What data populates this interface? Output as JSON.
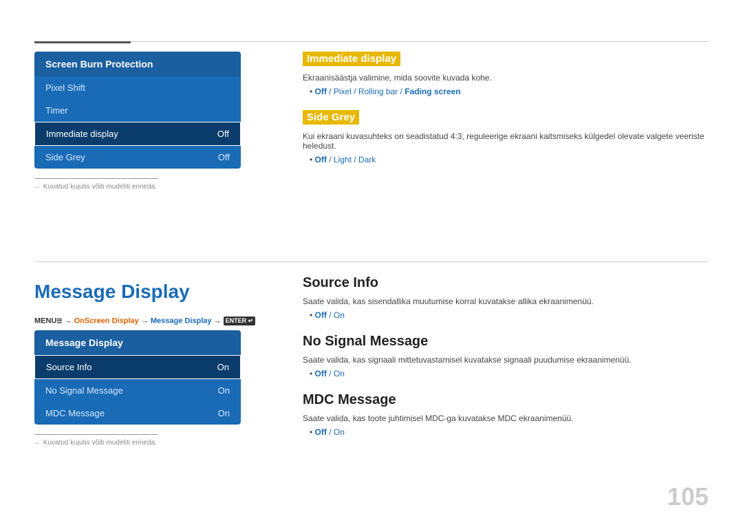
{
  "topRule": true,
  "leftTop": {
    "panel": {
      "title": "Screen Burn Protection",
      "items": [
        {
          "label": "Pixel Shift",
          "value": "",
          "active": false
        },
        {
          "label": "Timer",
          "value": "",
          "active": false
        },
        {
          "label": "Immediate display",
          "value": "Off",
          "active": true
        },
        {
          "label": "Side Grey",
          "value": "Off",
          "active": false
        }
      ]
    },
    "note": "← Kuvatud kujutis võib mudeliti erineda."
  },
  "rightTop": {
    "sections": [
      {
        "title": "Immediate display",
        "desc": "Ekraanisäästja valimine, mida soovite kuvada kohe.",
        "options": "Off / Pixel / Rolling bar / Fading screen",
        "boldParts": [
          "Off"
        ]
      },
      {
        "title": "Side Grey",
        "desc": "Kui ekraani kuvasuhteks on seadistatud 4:3, reguleerige ekraani kaitsmiseks külgedel olevate valgete veeriste heledust.",
        "options": "Off / Light / Dark",
        "boldParts": [
          "Off"
        ]
      }
    ]
  },
  "bottomLeft": {
    "heading": "Message Display",
    "navPath": {
      "menu": "MENU",
      "menuIcon": "☰",
      "steps": [
        "OnScreen Display",
        "Message Display"
      ],
      "enter": "ENTER"
    },
    "panel": {
      "title": "Message Display",
      "items": [
        {
          "label": "Source Info",
          "value": "On",
          "active": true
        },
        {
          "label": "No Signal Message",
          "value": "On",
          "active": false
        },
        {
          "label": "MDC Message",
          "value": "On",
          "active": false
        }
      ]
    },
    "note": "← Kuvatud kujutis võib mudeliti erineda."
  },
  "bottomRight": {
    "sections": [
      {
        "title": "Source Info",
        "desc": "Saate valida, kas sisendallika muutumise korral kuvatakse allika ekraanimenüü.",
        "options": "Off / On",
        "boldParts": [
          "Off"
        ]
      },
      {
        "title": "No Signal Message",
        "desc": "Saate valida, kas signaali mittetuvastamisel kuvatakse signaali puudumise ekraanimenüü.",
        "options": "Off / On",
        "boldParts": [
          "Off"
        ]
      },
      {
        "title": "MDC Message",
        "desc": "Saate valida, kas toote juhtimisel MDC-ga kuvatakse MDC ekraanimenüü.",
        "options": "Off / On",
        "boldParts": [
          "Off"
        ]
      }
    ]
  },
  "pageNumber": "105"
}
